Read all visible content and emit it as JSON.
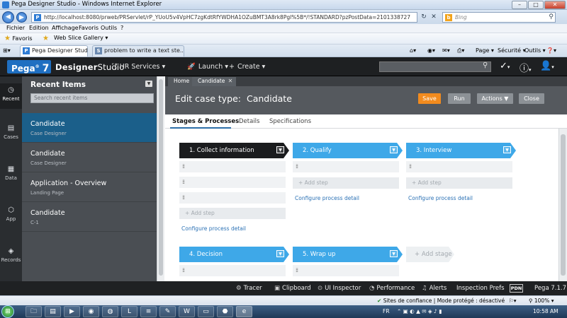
{
  "window": {
    "title": "Pega Designer Studio - Windows Internet Explorer",
    "controls": {
      "minimize": "–",
      "maximize": "□",
      "close": "✕"
    }
  },
  "browser": {
    "url": "http://localhost:8080/prweb/PRServlet/rP_YUoU5v4VpHC7zgKdtRfYWDHA1OZuBMT3A8rk8Pgl%5B*/!STANDARD?pzPostData=2101338727",
    "search_placeholder": "Bing",
    "menu": [
      "Fichier",
      "Edition",
      "Affichage",
      "Favoris",
      "Outils",
      "?"
    ],
    "favorites_label": "Favoris",
    "web_slice_gallery": "Web Slice Gallery ▾",
    "tabs": [
      {
        "label": "Pega Designer Studio",
        "active": true
      },
      {
        "label": "problem to write a text ste...",
        "active": false
      }
    ],
    "commands": {
      "page": "Page ▾",
      "security": "Sécurité ▾",
      "tools": "Outils ▾",
      "help": "❓▾"
    }
  },
  "header": {
    "logo_text": "Pega",
    "logo_version": "7",
    "studio_bold": "Designer",
    "studio_light": "Studio",
    "hr_services": "HR Services ▾",
    "launch": "Launch ▾",
    "create": "Create ▾",
    "search_value": ""
  },
  "rail": {
    "items": [
      {
        "label": "Recent",
        "icon": "clock-icon"
      },
      {
        "label": "Cases",
        "icon": "briefcase-icon"
      },
      {
        "label": "Data",
        "icon": "grid-icon"
      },
      {
        "label": "App",
        "icon": "cube-icon"
      },
      {
        "label": "Records",
        "icon": "layers-icon"
      }
    ]
  },
  "recent": {
    "title": "Recent Items",
    "search_placeholder": "Search recent items",
    "items": [
      {
        "title": "Candidate",
        "subtitle": "Case Designer",
        "active": true
      },
      {
        "title": "Candidate",
        "subtitle": "Case Designer",
        "active": false
      },
      {
        "title": "Application - Overview",
        "subtitle": "Landing Page",
        "active": false
      },
      {
        "title": "Candidate",
        "subtitle": "C-1",
        "active": false
      }
    ]
  },
  "main": {
    "tabs": [
      {
        "label": "Home"
      },
      {
        "label": "Candidate",
        "close": "✕"
      }
    ],
    "case_title_prefix": "Edit case type:",
    "case_title_name": "Candidate",
    "buttons": {
      "save": "Save",
      "run": "Run",
      "actions": "Actions ▼",
      "close": "Close"
    },
    "subtabs": [
      "Stages & Processes",
      "Details",
      "Specifications"
    ],
    "stages": [
      {
        "label": "1.  Collect information",
        "style": "dark"
      },
      {
        "label": "2.  Qualify",
        "style": "blue"
      },
      {
        "label": "3.  Interview",
        "style": "blue"
      },
      {
        "label": "4.  Decision",
        "style": "blue"
      },
      {
        "label": "5.  Wrap up",
        "style": "blue"
      },
      {
        "label": "+ Add stage",
        "style": "add"
      }
    ],
    "add_step": "+ Add step",
    "configure_process": "Configure process detail"
  },
  "devbar": {
    "tracer": "Tracer",
    "clipboard": "Clipboard",
    "ui_inspector": "UI Inspector",
    "performance": "Performance",
    "alerts": "Alerts",
    "inspection_prefs": "Inspection Prefs",
    "pdn": "PDN",
    "version": "Pega 7.1.7"
  },
  "iestatus": {
    "zone": "Sites de confiance | Mode protégé : désactivé",
    "zoom": "100%"
  },
  "taskbar": {
    "lang": "FR",
    "time": "10:58 AM"
  },
  "colors": {
    "accent_save": "#f28b1e",
    "stage_blue": "#3ea8e8",
    "selected_recent": "#1b5f8a",
    "header_bg": "#1e2022"
  }
}
